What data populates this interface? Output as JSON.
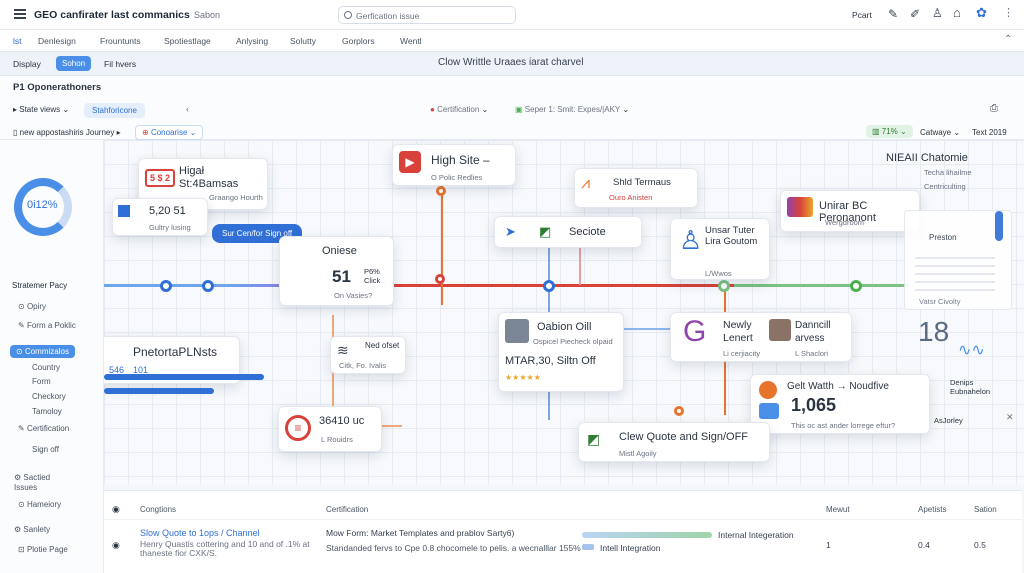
{
  "header": {
    "app_title": "GEO canfirater last commanics",
    "subtitle": "Sabon",
    "search_placeholder": "Gerfication issue",
    "account_label": "Pcart"
  },
  "tabs": [
    "lst",
    "Denlesign",
    "Frountunts",
    "Spotiestlage",
    "Anlysing",
    "Solutty",
    "Gorplors",
    "Wentl"
  ],
  "modebar": {
    "display": "Display",
    "active": "Sohon",
    "filter": "Fil hvers",
    "center_title": "Clow Writtle Uraaes iarat charvel"
  },
  "subbar": {
    "section_title": "P1 Oponerathoners",
    "state_views": "State views",
    "stat_pill": "Stahforicone",
    "legend_1": "Certification",
    "legend_2": "Seper 1: Smit: Expes/|AKY",
    "journey": "new appostashiris Journey",
    "comparison": "Conoarise",
    "pct": "71%",
    "category": "Catwaye",
    "text_label": "Text 2019"
  },
  "sidebar": {
    "ring_value": "0i12%",
    "heading": "Stratemer Pacy",
    "items": [
      "Opiry",
      "Form a Poklic"
    ],
    "active": "Commizalos",
    "sub_items": [
      "Country",
      "Form",
      "Checkory",
      "Tamoloy",
      "Certification",
      "Sign off"
    ],
    "group2": "Sactied Issues",
    "group2_items": [
      "Hameiory"
    ],
    "group3": "Sanlety",
    "group3_items": [
      "Plotie Page"
    ]
  },
  "nodes": {
    "n1": {
      "title": "Higał St:4Bamsas",
      "sub": "Graango Hourth",
      "badge": "5 $ 2"
    },
    "n2": {
      "title": "High Site –",
      "sub": "O Polic Redlies"
    },
    "n3": {
      "title": "Shld Termaus",
      "sub": "Ouro Anisten"
    },
    "n4": {
      "title": "Unirar BC Peronanont",
      "sub": "Wergdroom"
    },
    "n5": {
      "title": "NIEAII Chatomie",
      "sub": "Techa lihailme",
      "sub2": "Centriculting"
    },
    "n6": {
      "value": "5,20 51",
      "sub": "Gultry lusing"
    },
    "n7": {
      "label": "Sur Cen/for Sign off"
    },
    "n8": {
      "title": "Oniese",
      "value": "51",
      "pct": "P6% Click",
      "sub": "On Vasies?"
    },
    "n9": {
      "title": "Seciote"
    },
    "n10": {
      "title": "Unsar Tuter Lira Goutom",
      "sub": "L/Wwos"
    },
    "n11": {
      "title": "Preston"
    },
    "n12": {
      "title": "PnetortaPLNsts",
      "v1": "546",
      "v2": "101"
    },
    "n13": {
      "title": "Ned ofset",
      "sub": "Citk, Fo. Ivalis"
    },
    "n14": {
      "title": "Oabion Oill",
      "sub": "Ospicel Piecheck olpaid",
      "value": "MTAR,30, Siltn Off"
    },
    "n15": {
      "title": "Newly Lenert",
      "sub": "Li cerjiacity"
    },
    "n16": {
      "title": "Danncill arvess",
      "sub": "L Shaclori"
    },
    "n17": {
      "title": "Gelt Watth → Noudfive",
      "value": "1,065",
      "sub": "This oc ast ander lorrege eftur?"
    },
    "n18": {
      "title": "Denips Eubnahelon",
      "sub": "AsJorley"
    },
    "n19": {
      "value": "36410 uc",
      "sub": "L Rouidrs"
    },
    "n20": {
      "title": "Clew Quote and Sign/OFF",
      "sub": "Mistl Agoily"
    },
    "n21": {
      "value": "18"
    },
    "n22": {
      "sub": "Vatsr Civolty"
    }
  },
  "table": {
    "headers": [
      "Congtions",
      "Certification",
      "Mewut",
      "Apetists",
      "Sation"
    ],
    "row": {
      "link": "Slow Quote to 1ops / Channel",
      "desc": "Henry Quastis cottering and 10 and of .1% at thaneste fior CXK/S.",
      "cert": "Mow Form: Market Templates and prablov Sarty6)",
      "cert2": "Standanded fervs to Cpe 0.8 chocomele to pelis. a wecnalllar 155%",
      "bar1": "Internal Integeration",
      "bar2": "Intell Integration",
      "meta": "1",
      "apt": "0.4",
      "sat": "0.5"
    }
  },
  "colors": {
    "accent": "#2f6fd6",
    "orange": "#e8742c",
    "red": "#d9413b",
    "green": "#4caf50",
    "purple": "#8e44ad"
  }
}
